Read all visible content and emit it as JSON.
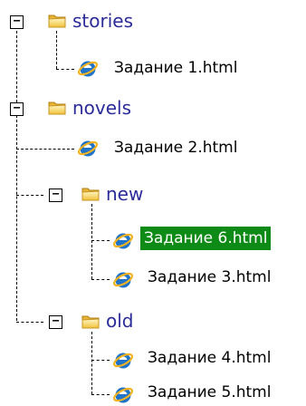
{
  "tree": {
    "toggle_symbol": "−",
    "folders": [
      {
        "name": "stories",
        "expanded": true
      },
      {
        "name": "novels",
        "expanded": true
      },
      {
        "name": "new",
        "expanded": true
      },
      {
        "name": "old",
        "expanded": true
      }
    ],
    "files": [
      {
        "name": "Задание 1.html",
        "selected": false
      },
      {
        "name": "Задание 2.html",
        "selected": false
      },
      {
        "name": "Задание 6.html",
        "selected": true
      },
      {
        "name": "Задание 3.html",
        "selected": false
      },
      {
        "name": "Задание 4.html",
        "selected": false
      },
      {
        "name": "Задание 5.html",
        "selected": false
      }
    ],
    "colors": {
      "folder_label": "#2b2b99",
      "selection": "#0e8a16",
      "connector": "#000000"
    },
    "icons": {
      "folder": "folder-icon",
      "file": "internet-explorer-icon",
      "toggle": "collapse-toggle-icon"
    }
  }
}
